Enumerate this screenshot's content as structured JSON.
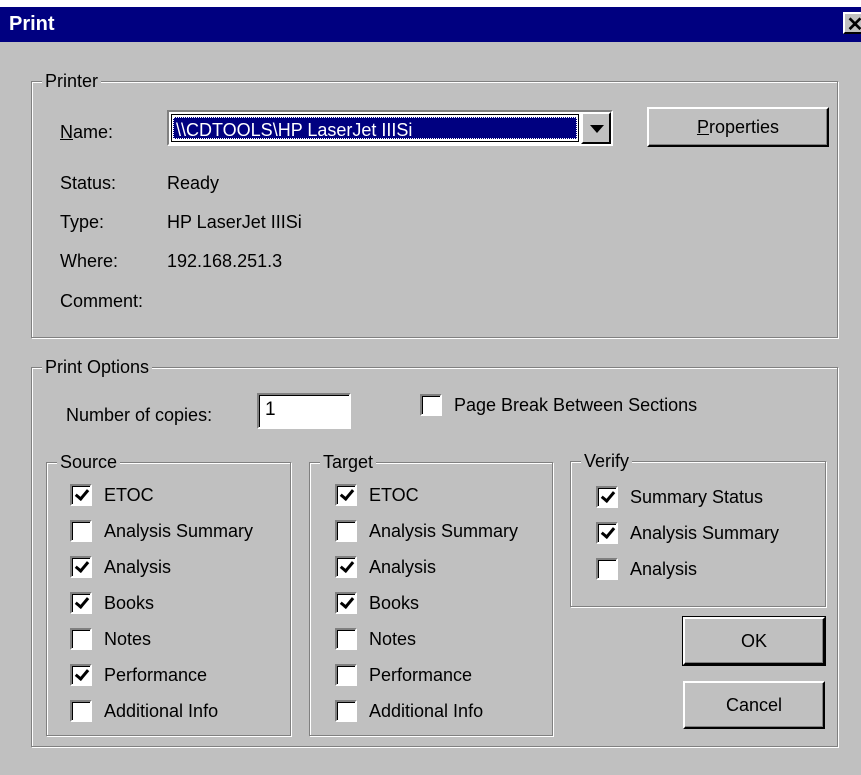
{
  "window": {
    "title": "Print",
    "close_glyph": "✕"
  },
  "printer": {
    "group_label": "Printer",
    "name_label": "Name:",
    "name_value": "\\\\CDTOOLS\\HP LaserJet IIISi",
    "properties_label": "Properties",
    "status_label": "Status:",
    "status_value": "Ready",
    "type_label": "Type:",
    "type_value": "HP LaserJet IIISi",
    "where_label": "Where:",
    "where_value": "192.168.251.3",
    "comment_label": "Comment:",
    "comment_value": ""
  },
  "options": {
    "group_label": "Print Options",
    "copies_label": "Number of copies:",
    "copies_value": "1",
    "page_break": {
      "label": "Page Break Between Sections",
      "checked": false
    }
  },
  "source": {
    "label": "Source",
    "items": [
      {
        "label": "ETOC",
        "checked": true
      },
      {
        "label": "Analysis Summary",
        "checked": false
      },
      {
        "label": "Analysis",
        "checked": true
      },
      {
        "label": "Books",
        "checked": true
      },
      {
        "label": "Notes",
        "checked": false
      },
      {
        "label": "Performance",
        "checked": true
      },
      {
        "label": "Additional Info",
        "checked": false
      }
    ]
  },
  "target": {
    "label": "Target",
    "items": [
      {
        "label": "ETOC",
        "checked": true
      },
      {
        "label": "Analysis Summary",
        "checked": false
      },
      {
        "label": "Analysis",
        "checked": true
      },
      {
        "label": "Books",
        "checked": true
      },
      {
        "label": "Notes",
        "checked": false
      },
      {
        "label": "Performance",
        "checked": false
      },
      {
        "label": "Additional Info",
        "checked": false
      }
    ]
  },
  "verify": {
    "label": "Verify",
    "items": [
      {
        "label": "Summary Status",
        "checked": true
      },
      {
        "label": "Analysis Summary",
        "checked": true
      },
      {
        "label": "Analysis",
        "checked": false
      }
    ]
  },
  "buttons": {
    "ok_label": "OK",
    "cancel_label": "Cancel"
  }
}
